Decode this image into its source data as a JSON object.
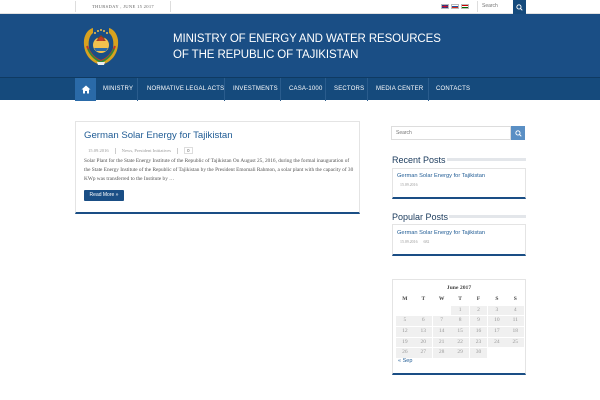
{
  "topbar": {
    "date": "THURSDAY , JUNE 15 2017",
    "search_placeholder": "Search"
  },
  "header": {
    "title_line1": "MINISTRY OF ENERGY AND WATER RESOURCES",
    "title_line2": "OF THE REPUBLIC OF TAJIKISTAN"
  },
  "nav": {
    "items": [
      "MINISTRY",
      "NORMATIVE LEGAL ACTS",
      "INVESTMENTS",
      "CASA-1000",
      "SECTORS",
      "MEDIA CENTER",
      "CONTACTS"
    ]
  },
  "post": {
    "title": "German Solar Energy for Tajikistan",
    "date": "15.09.2016",
    "category": "News, President Initiatives",
    "comments": "0",
    "excerpt": "Solar Plant for the State Energy Institute of the Republic of Tajikistan On August 25, 2016, during the formal inauguration of the State Energy Institute of the Republic of Tajikistan by the President Emomali Rahmon, a solar plant with the capacity of 30 KWp was transferred to the Institute by …",
    "read_more": "Read More »"
  },
  "sidebar": {
    "search_placeholder": "Search",
    "recent_title": "Recent Posts",
    "recent_post_title": "German Solar Energy for Tajikistan",
    "recent_post_date": "15.09.2016",
    "popular_title": "Popular Posts",
    "popular_post_title": "German Solar Energy for Tajikistan",
    "popular_post_date": "15.09.2016",
    "popular_post_views": "682",
    "calendar": {
      "caption": "June 2017",
      "weekdays": [
        "M",
        "T",
        "W",
        "T",
        "F",
        "S",
        "S"
      ],
      "weeks": [
        [
          "",
          "",
          "",
          "1",
          "2",
          "3",
          "4"
        ],
        [
          "5",
          "6",
          "7",
          "8",
          "9",
          "10",
          "11"
        ],
        [
          "12",
          "13",
          "14",
          "15",
          "16",
          "17",
          "18"
        ],
        [
          "19",
          "20",
          "21",
          "22",
          "23",
          "24",
          "25"
        ],
        [
          "26",
          "27",
          "28",
          "29",
          "30",
          "",
          ""
        ]
      ],
      "prev_link": "« Sep"
    }
  },
  "colors": {
    "header_bg": "#1a4e85",
    "nav_bg": "#154a7c",
    "link": "#1f5b94",
    "accent_button": "#5a8fc4"
  },
  "icons": {
    "home": "home-icon",
    "search": "search-icon",
    "emblem": "emblem-icon"
  }
}
